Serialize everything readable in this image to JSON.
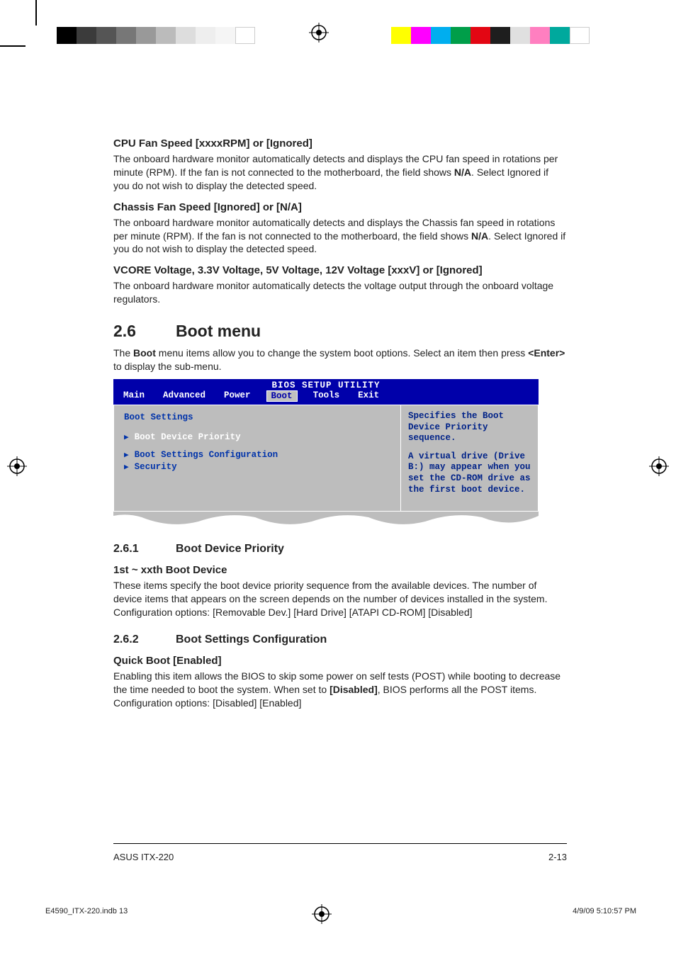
{
  "sections": {
    "cpu_fan": {
      "heading": "CPU Fan Speed [xxxxRPM] or [Ignored]",
      "para_prefix": "The onboard hardware monitor automatically detects and displays the CPU fan speed in rotations per minute (RPM). If the fan is not connected to the motherboard, the field shows ",
      "bold": "N/A",
      "para_suffix": ". Select Ignored if you do not wish to display the detected speed."
    },
    "chassis_fan": {
      "heading": "Chassis Fan Speed [Ignored] or [N/A]",
      "para_prefix": "The onboard hardware monitor automatically detects and displays the Chassis fan speed in rotations per minute (RPM). If the fan is not connected to the motherboard, the field shows ",
      "bold": "N/A",
      "para_suffix": ". Select Ignored if you do not wish to display the detected speed."
    },
    "vcore": {
      "heading": "VCORE Voltage, 3.3V Voltage, 5V Voltage, 12V Voltage [xxxV] or [Ignored]",
      "para": "The onboard hardware monitor automatically detects the voltage output through the onboard voltage regulators."
    },
    "boot_menu": {
      "num": "2.6",
      "title": "Boot menu",
      "intro_prefix": "The ",
      "intro_bold1": "Boot",
      "intro_mid": " menu items allow you to change the system boot options. Select an item then press ",
      "intro_bold2": "<Enter>",
      "intro_suffix": " to display the sub-menu."
    },
    "bios": {
      "title": "BIOS SETUP UTILITY",
      "tabs": [
        "Main",
        "Advanced",
        "Power",
        "Boot",
        "Tools",
        "Exit"
      ],
      "active_tab": "Boot",
      "left_title": "Boot Settings",
      "items": [
        {
          "label": "Boot Device Priority",
          "selected": true
        },
        {
          "label": "Boot Settings Configuration",
          "selected": false
        },
        {
          "label": "Security",
          "selected": false
        }
      ],
      "help1": "Specifies the Boot Device Priority sequence.",
      "help2": "A virtual drive (Drive B:) may appear when you set the CD-ROM drive as the first boot device."
    },
    "s261": {
      "num": "2.6.1",
      "title": "Boot Device Priority",
      "sub": "1st ~ xxth Boot Device",
      "para": "These items specify the boot device priority sequence from the available devices. The number of device items that appears on the screen depends on the number of devices installed in the system. Configuration options: [Removable Dev.] [Hard Drive] [ATAPI CD-ROM] [Disabled]"
    },
    "s262": {
      "num": "2.6.2",
      "title": "Boot Settings Configuration",
      "sub": "Quick Boot [Enabled]",
      "para_prefix": "Enabling this item allows the BIOS to skip some power on self tests (POST) while booting to decrease the time needed to boot the system. When set to ",
      "bold": "[Disabled]",
      "para_suffix": ", BIOS performs all the POST items. Configuration options: [Disabled] [Enabled]"
    }
  },
  "footer": {
    "product": "ASUS ITX-220",
    "page_num": "2-13"
  },
  "meta": {
    "file": "E4590_ITX-220.indb   13",
    "timestamp": "4/9/09   5:10:57 PM"
  }
}
